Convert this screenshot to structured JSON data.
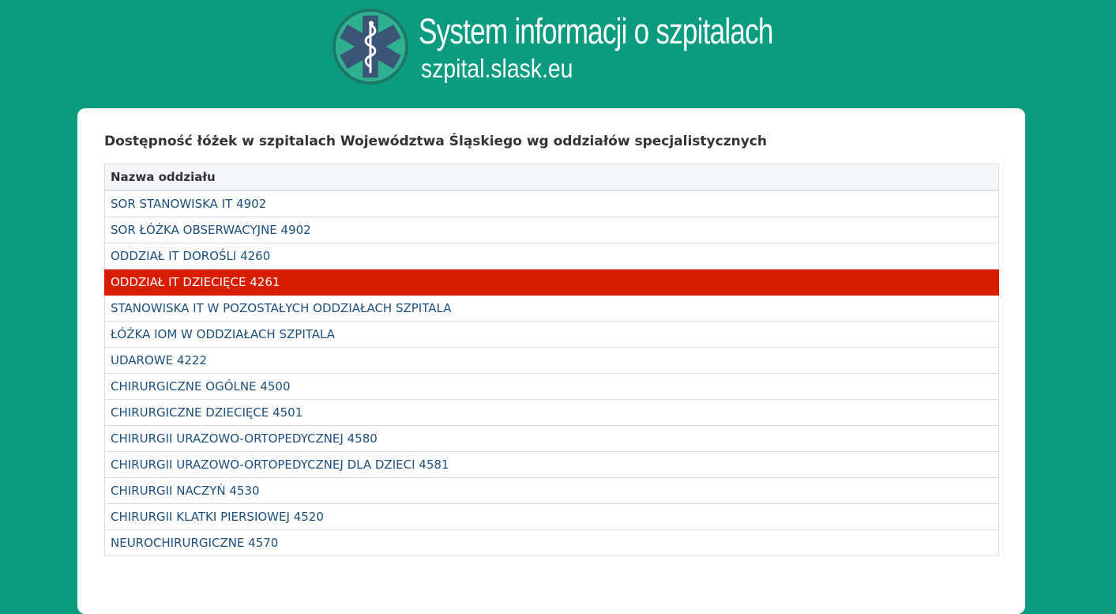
{
  "header": {
    "title": "System informacji o szpitalach",
    "subtitle": "szpital.slask.eu",
    "logo_icon": "star-of-life-icon"
  },
  "colors": {
    "background": "#0b9c80",
    "highlight_row": "#d81d00",
    "link_text": "#1d4f7c"
  },
  "main": {
    "title": "Dostępność łóżek w szpitalach Województwa Śląskiego wg oddziałów specjalistycznych",
    "table": {
      "column_header": "Nazwa oddziału",
      "rows": [
        {
          "name": "SOR STANOWISKA IT 4902"
        },
        {
          "name": "SOR ŁÓŻKA OBSERWACYJNE 4902"
        },
        {
          "name": "ODDZIAŁ IT DOROŚLI 4260"
        },
        {
          "name": "ODDZIAŁ IT DZIECIĘCE 4261",
          "highlighted": true
        },
        {
          "name": "STANOWISKA IT W POZOSTAŁYCH ODDZIAŁACH SZPITALA"
        },
        {
          "name": "ŁÓŻKA IOM W ODDZIAŁACH SZPITALA"
        },
        {
          "name": "UDAROWE 4222"
        },
        {
          "name": "CHIRURGICZNE OGÓLNE 4500"
        },
        {
          "name": "CHIRURGICZNE DZIECIĘCE 4501"
        },
        {
          "name": "CHIRURGII URAZOWO-ORTOPEDYCZNEJ 4580"
        },
        {
          "name": "CHIRURGII URAZOWO-ORTOPEDYCZNEJ DLA DZIECI 4581"
        },
        {
          "name": "CHIRURGII NACZYŃ 4530"
        },
        {
          "name": "CHIRURGII KLATKI PIERSIOWEJ 4520"
        },
        {
          "name": "NEUROCHIRURGICZNE 4570"
        }
      ]
    }
  }
}
